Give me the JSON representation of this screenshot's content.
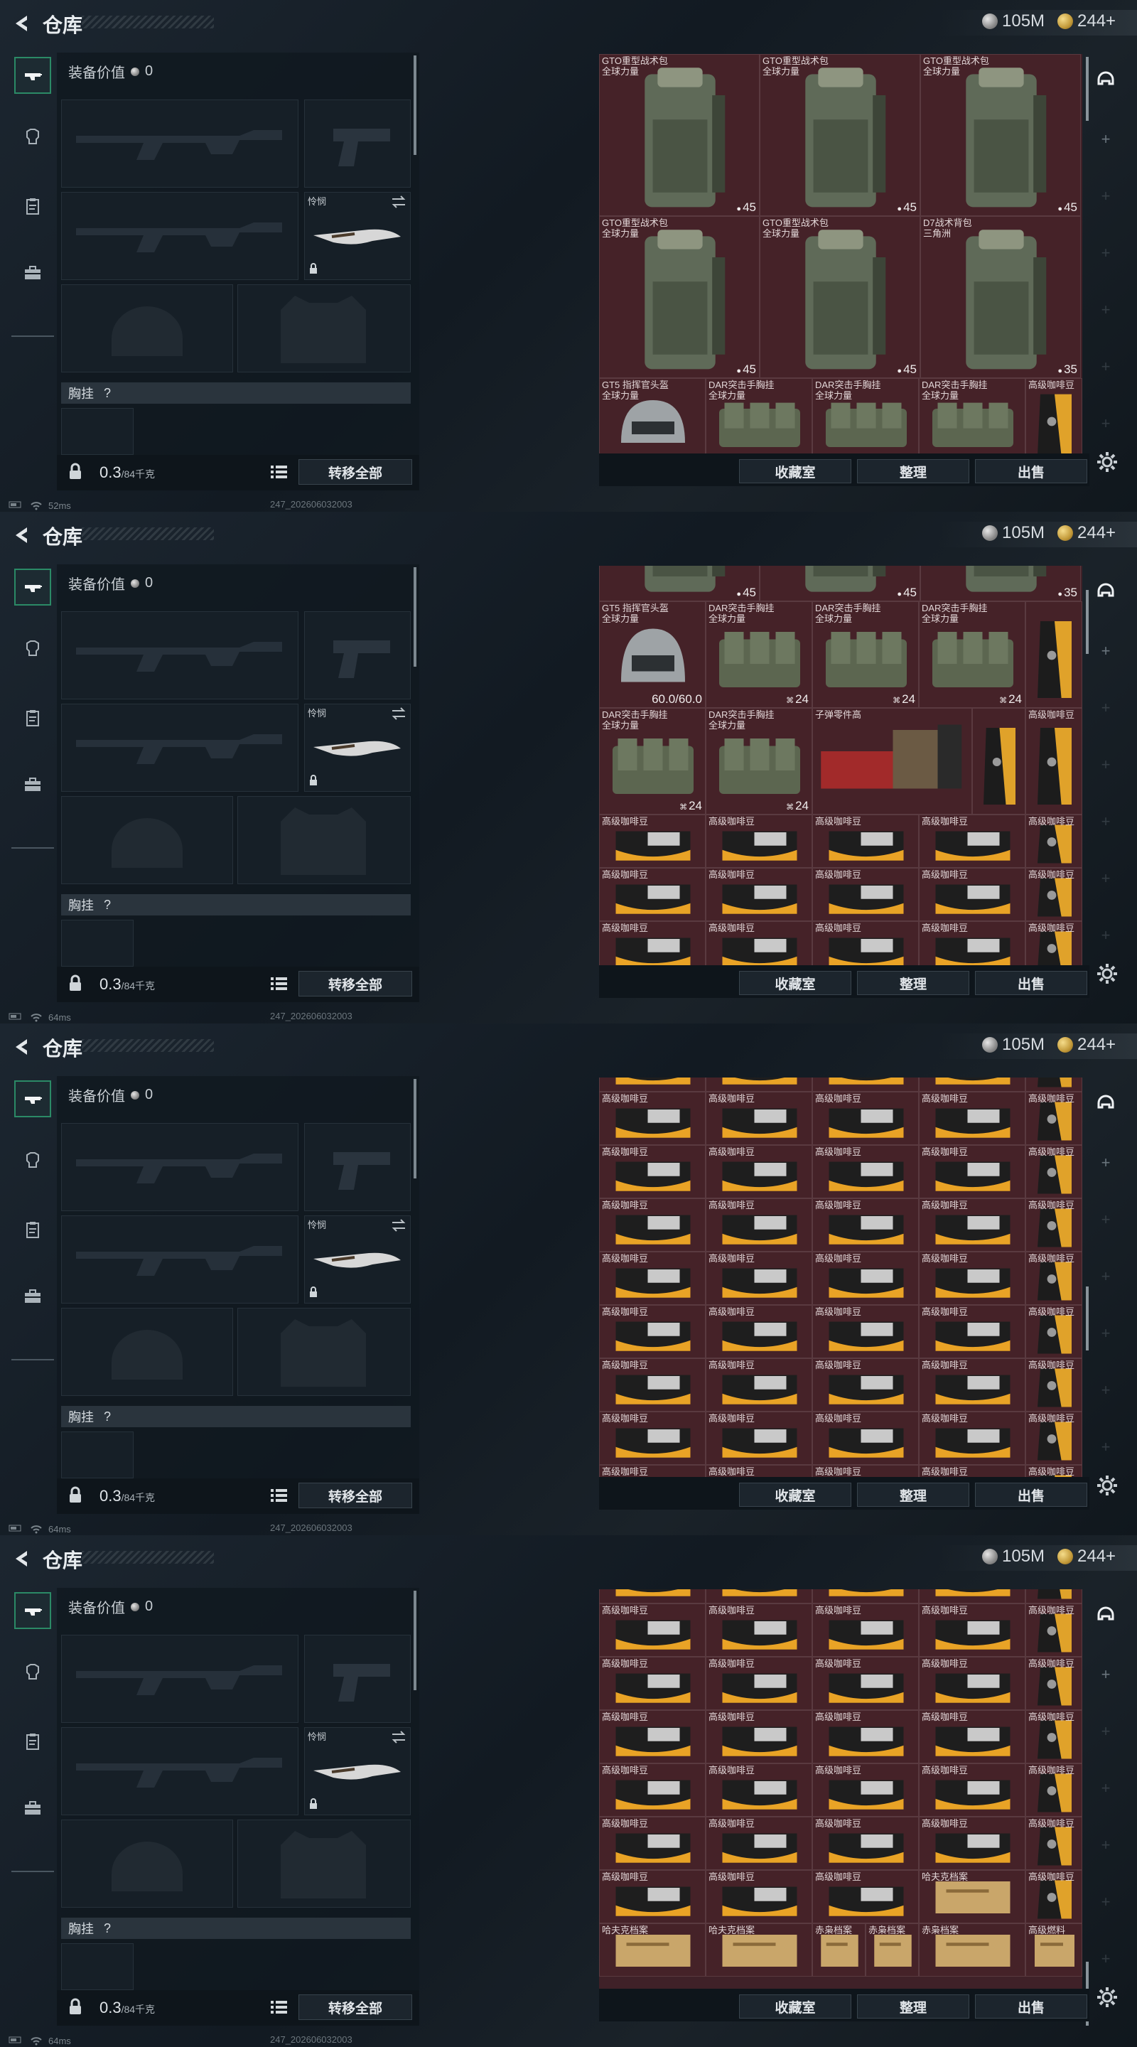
{
  "app": {
    "title": "仓库",
    "currency": [
      {
        "icon": "silver-coin-icon",
        "value": "105M"
      },
      {
        "icon": "gold-coin-icon",
        "value": "244+"
      }
    ],
    "equipment_value_label": "装备价值",
    "equipment_value": "0",
    "melee_label": "怜悯",
    "chest_rig_label": "胸挂",
    "chest_rig_hint": "?",
    "weight": "0.3",
    "weight_max": "/84千克",
    "transfer_all": "转移全部",
    "buttons": {
      "collection": "收藏室",
      "sort": "整理",
      "sell": "出售"
    },
    "build_id": "247_202606032003",
    "tabs": [
      "weapon-icon",
      "armor-icon",
      "clipboard-icon",
      "briefcase-icon"
    ],
    "accent": "#2b8a66",
    "storage_bg": "#452228"
  },
  "frames": [
    {
      "ping": "52ms",
      "cells": [
        {
          "name": "GTO重型战术包\n全球力量",
          "qty": "45",
          "qty_icon": "weight-icon",
          "kind": "backpack"
        },
        {
          "name": "GTO重型战术包\n全球力量",
          "qty": "45",
          "qty_icon": "weight-icon",
          "kind": "backpack"
        },
        {
          "name": "GTO重型战术包\n全球力量",
          "qty": "45",
          "qty_icon": "weight-icon",
          "kind": "backpack"
        },
        {
          "name": "GTO重型战术包\n全球力量",
          "qty": "45",
          "qty_icon": "weight-icon",
          "kind": "backpack"
        },
        {
          "name": "GTO重型战术包\n全球力量",
          "qty": "45",
          "qty_icon": "weight-icon",
          "kind": "backpack"
        },
        {
          "name": "D7战术背包\n三角洲",
          "qty": "35",
          "qty_icon": "weight-icon",
          "kind": "backpack"
        },
        {
          "name": "GT5 指挥官头盔\n全球力量",
          "qty": "",
          "kind": "helmet"
        },
        {
          "name": "DAR突击手胸挂\n全球力量",
          "qty": "",
          "kind": "rig"
        },
        {
          "name": "DAR突击手胸挂\n全球力量",
          "qty": "",
          "kind": "rig"
        },
        {
          "name": "DAR突击手胸挂\n全球力量",
          "qty": "",
          "kind": "rig"
        },
        {
          "name": "高级咖啡豆",
          "qty": "",
          "kind": "coffee"
        }
      ]
    },
    {
      "ping": "64ms",
      "cells": [
        {
          "name": "",
          "qty": "45",
          "qty_icon": "weight-icon",
          "kind": "backpack"
        },
        {
          "name": "",
          "qty": "45",
          "qty_icon": "weight-icon",
          "kind": "backpack"
        },
        {
          "name": "",
          "qty": "35",
          "qty_icon": "weight-icon",
          "kind": "backpack"
        },
        {
          "name": "GT5 指挥官头盔\n全球力量",
          "qty": "60.0/60.0",
          "kind": "helmet"
        },
        {
          "name": "DAR突击手胸挂\n全球力量",
          "qty": "24",
          "qty_icon": "rig-icon",
          "kind": "rig"
        },
        {
          "name": "DAR突击手胸挂\n全球力量",
          "qty": "24",
          "qty_icon": "rig-icon",
          "kind": "rig"
        },
        {
          "name": "DAR突击手胸挂\n全球力量",
          "qty": "24",
          "qty_icon": "rig-icon",
          "kind": "rig"
        },
        {
          "name": "",
          "qty": "",
          "kind": "coffee"
        },
        {
          "name": "DAR突击手胸挂\n全球力量",
          "qty": "24",
          "qty_icon": "rig-icon",
          "kind": "rig"
        },
        {
          "name": "DAR突击手胸挂\n全球力量",
          "qty": "24",
          "qty_icon": "rig-icon",
          "kind": "rig"
        },
        {
          "name": "子弹零件高",
          "qty": "",
          "kind": "parts"
        },
        {
          "name": "",
          "qty": "",
          "kind": "coffee"
        },
        {
          "name": "高级咖啡豆",
          "qty": "",
          "kind": "coffee"
        },
        {
          "name": "高级咖啡豆",
          "qty": "",
          "kind": "coffee"
        }
      ]
    },
    {
      "ping": "64ms"
    },
    {
      "ping": "64ms"
    }
  ],
  "coffee_label": "高级咖啡豆",
  "frame4_bottom": [
    "哈夫克档案",
    "哈夫克档案",
    "赤枭档案",
    "赤枭档案",
    "赤枭档案",
    "高级燃料"
  ],
  "frame4_special": "哈夫克档案"
}
